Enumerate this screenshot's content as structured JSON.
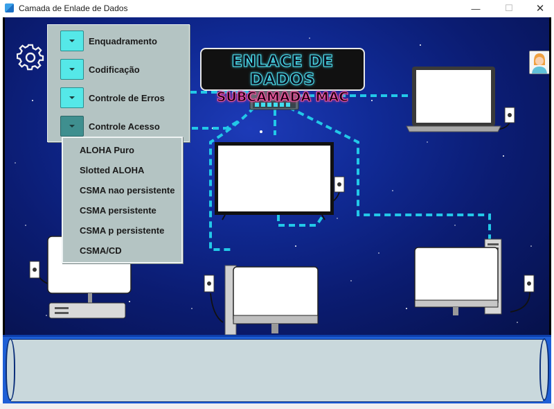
{
  "window": {
    "title": "Camada de Enlade de Dados",
    "minimize": "—",
    "maximize": "☐",
    "close": "✕"
  },
  "logo": {
    "line1": "ENLACE DE DADOS",
    "line2": "SUBCAMADA MAC"
  },
  "menu": {
    "items": [
      {
        "label": "Enquadramento",
        "icon": "chevron-down-icon"
      },
      {
        "label": "Codificação",
        "icon": "chevron-down-icon"
      },
      {
        "label": "Controle de Erros",
        "icon": "chevron-down-icon"
      },
      {
        "label": "Controle Acesso",
        "icon": "chevron-down-icon",
        "expanded": true
      }
    ]
  },
  "submenu": {
    "items": [
      {
        "label": "ALOHA Puro"
      },
      {
        "label": "Slotted ALOHA"
      },
      {
        "label": "CSMA nao persistente"
      },
      {
        "label": "CSMA persistente"
      },
      {
        "label": "CSMA p persistente"
      },
      {
        "label": "CSMA/CD"
      }
    ]
  },
  "icons": {
    "settings": "gear-icon",
    "user": "avatar-icon",
    "switch": "network-switch-icon"
  },
  "colors": {
    "menu_bg": "#b4c4c3",
    "dropdown_button": "#55e8e8",
    "link_dash": "#22c8e8",
    "panel_blue": "#1e5fd6",
    "logo_cyan": "#55f2ff",
    "logo_pink": "#ff5aa8"
  }
}
